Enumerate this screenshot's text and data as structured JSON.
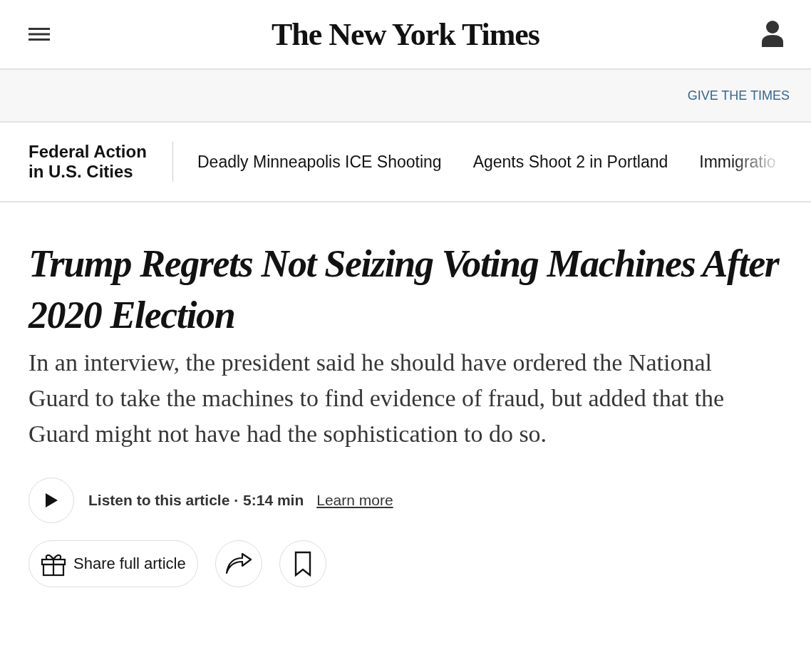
{
  "header": {
    "logo": "The New York Times"
  },
  "promo_bar": {
    "link": "GIVE THE TIMES"
  },
  "topic_nav": {
    "title": "Federal Action in U.S. Cities",
    "items": [
      "Deadly Minneapolis ICE Shooting",
      "Agents Shoot 2 in Portland",
      "Immigratio"
    ]
  },
  "article": {
    "headline": "Trump Regrets Not Seizing Voting Machines After 2020 Election",
    "summary": "In an interview, the president said he should have ordered the National Guard to take the machines to find evidence of fraud, but added that the Guard might not have had the sophistication to do so.",
    "audio": {
      "label": "Listen to this article · 5:14 min",
      "link": "Learn more"
    },
    "share_button": "Share full article"
  }
}
